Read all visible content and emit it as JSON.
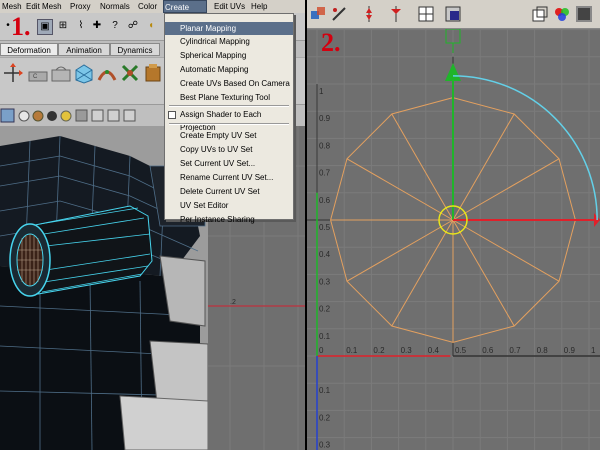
{
  "left_panel": {
    "menubar": [
      "Mesh",
      "Edit Mesh",
      "Proxy",
      "Normals",
      "Color",
      "Create UVs",
      "Edit UVs",
      "Help"
    ],
    "active_menu": "Create UVs",
    "shelf_tabs": [
      "Deformation",
      "Animation",
      "Dynamics"
    ],
    "selected_shelf_tab": "Deformation",
    "step_label": "1.",
    "dropdown": {
      "items": [
        {
          "label": "Planar Mapping",
          "highlight": true
        },
        {
          "label": "Cylindrical Mapping"
        },
        {
          "label": "Spherical Mapping"
        },
        {
          "label": "Automatic Mapping"
        },
        {
          "label": "Create UVs Based On Camera"
        },
        {
          "label": "Best Plane Texturing Tool"
        },
        {
          "label": "Assign Shader to Each Projection",
          "checkbox": true
        },
        {
          "label": "Create Empty UV Set"
        },
        {
          "label": "Copy UVs to UV Set"
        },
        {
          "label": "Set Current UV Set..."
        },
        {
          "label": "Rename Current UV Set..."
        },
        {
          "label": "Delete Current UV Set"
        },
        {
          "label": "UV Set Editor"
        },
        {
          "label": "Per Instance Sharing"
        }
      ]
    },
    "uv_tick": ".2"
  },
  "right_panel": {
    "step_label": "2.",
    "uv_editor": {
      "x_ticks": [
        "0",
        "0.1",
        "0.2",
        "0.3",
        "0.4",
        "0.5",
        "0.6",
        "0.7",
        "0.8",
        "0.9",
        "1"
      ],
      "y_ticks": [
        "1",
        "0.9",
        "0.8",
        "0.7",
        "0.6",
        "0.5",
        "0.4",
        "0.3",
        "0.2",
        "0.1",
        "0"
      ],
      "neg_y_ticks": [
        "0.1",
        "0.2",
        "0.3"
      ],
      "colors": {
        "u_axis": "#e0202a",
        "v_axis": "#1fb52a",
        "rotate_arc": "#63d0e8",
        "pivot": "#e8e41a",
        "mesh_edges": "#e3a05f",
        "grid": "#7b7b7b",
        "background": "#6f6f6f"
      }
    }
  }
}
